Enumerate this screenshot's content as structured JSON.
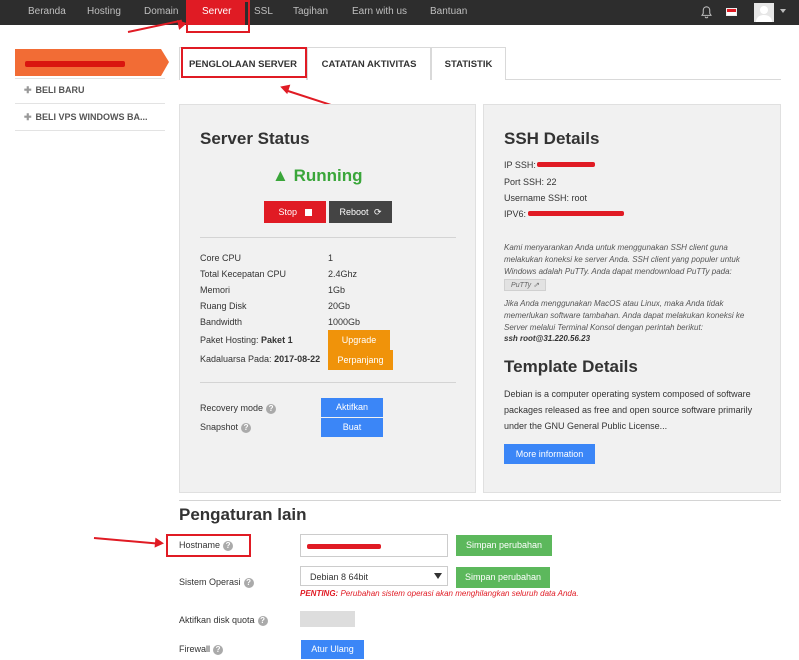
{
  "nav": {
    "items": [
      "Beranda",
      "Hosting",
      "Domain",
      "Server",
      "SSL",
      "Tagihan",
      "Earn with us",
      "Bantuan"
    ],
    "active": "Server",
    "icons": [
      "bell-icon",
      "flag-icon",
      "avatar"
    ]
  },
  "sidebar": {
    "items": [
      "BELI BARU",
      "BELI VPS WINDOWS BA..."
    ]
  },
  "tabs": [
    "PENGLOLAAN SERVER",
    "CATATAN AKTIVITAS",
    "STATISTIK"
  ],
  "server_status": {
    "title": "Server Status",
    "status": "Running",
    "stop_label": "Stop",
    "reboot_label": "Reboot",
    "specs": [
      {
        "label": "Core CPU",
        "value": "1"
      },
      {
        "label": "Total Kecepatan CPU",
        "value": "2.4Ghz"
      },
      {
        "label": "Memori",
        "value": "1Gb"
      },
      {
        "label": "Ruang Disk",
        "value": "20Gb"
      },
      {
        "label": "Bandwidth",
        "value": "1000Gb"
      }
    ],
    "paket_label": "Paket Hosting:",
    "paket_value": "Paket 1",
    "upgrade_label": "Upgrade",
    "kadaluarsa_label": "Kadaluarsa Pada:",
    "kadaluarsa_value": "2017-08-22",
    "perpanjang_label": "Perpanjang",
    "recovery_label": "Recovery mode",
    "recovery_btn": "Aktifkan",
    "snapshot_label": "Snapshot",
    "snapshot_btn": "Buat"
  },
  "ssh": {
    "title": "SSH Details",
    "ip_label": "IP SSH:",
    "port_label": "Port SSH: 22",
    "user_label": "Username SSH: root",
    "ipv6_label": "IPV6:",
    "note1": "Kami menyarankan Anda untuk menggunakan SSH client guna melakukan koneksi ke server Anda. SSH client yang populer untuk Windows adalah PuTTy. Anda dapat mendownload PuTTy pada:",
    "putty_label": "PuTTy",
    "note2": "Jika Anda menggunakan MacOS atau Linux, maka Anda tidak memerlukan software tambahan. Anda dapat melakukan koneksi ke Server melalui Terminal Konsol dengan perintah berikut:",
    "command": "ssh root@31.220.56.23"
  },
  "template": {
    "title": "Template Details",
    "description": "Debian is a computer operating system composed of software packages released as free and open source software primarily under the GNU General Public License...",
    "more_label": "More information"
  },
  "settings": {
    "title": "Pengaturan lain",
    "hostname_label": "Hostname",
    "save_label": "Simpan perubahan",
    "os_label": "Sistem Operasi",
    "os_value": "Debian 8 64bit",
    "pending_prefix": "PENTING:",
    "pending_text": "Perubahan sistem operasi akan menghilangkan seluruh data Anda.",
    "quota_label": "Aktifkan disk quota",
    "firewall_label": "Firewall",
    "firewall_btn": "Atur Ulang"
  },
  "colors": {
    "accent_red": "#e01b24",
    "nav_bg": "#2d2d2d",
    "sidebar_active": "#f26c35",
    "running_green": "#3aa63a",
    "button_blue": "#3b86f7",
    "button_orange": "#f0930a",
    "button_green": "#5cb85c"
  }
}
